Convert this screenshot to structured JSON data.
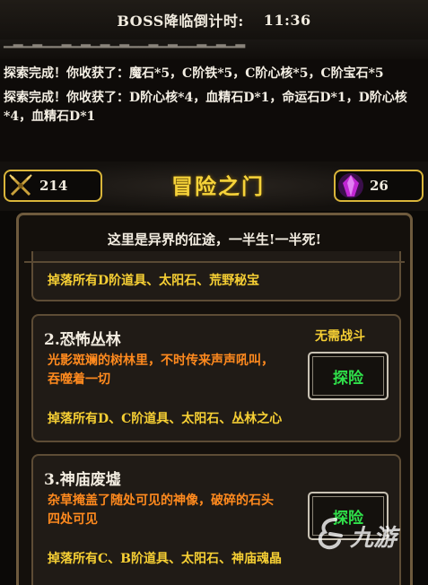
{
  "top_bar": {
    "countdown_label": "BOSS降临倒计时:",
    "countdown_time": "11:36"
  },
  "log": {
    "entries": [
      "探索完成！你收获了：魔石*5，C阶铁*5，C阶心核*5，C阶宝石*5",
      "探索完成！你收获了：D阶心核*4，血精石D*1，命运石D*1，D阶心核*4，血精石D*1"
    ]
  },
  "header": {
    "left_stat": {
      "icon": "crossed-swords-icon",
      "value": "214"
    },
    "title": "冒险之门",
    "right_stat": {
      "icon": "purple-crystal-icon",
      "value": "26"
    }
  },
  "panel": {
    "subtitle": "这里是异界的征途，一半生!一半死!",
    "cards": [
      {
        "drops": "掉落所有D阶道具、太阳石、荒野秘宝"
      },
      {
        "name": "2.恐怖丛林",
        "tag": "无需战斗",
        "description": "光影斑斓的树林里，不时传来声声吼叫，吞噬着一切",
        "button": "探险",
        "drops": "掉落所有D、C阶道具、太阳石、丛林之心"
      },
      {
        "name": "3.神庙废墟",
        "description": "杂草掩盖了随处可见的神像，破碎的石头四处可见",
        "button": "探险",
        "drops": "掉落所有C、B阶道具、太阳石、神庙魂晶"
      }
    ]
  },
  "watermark": {
    "text": "九游",
    "icon": "jiuyou-logo-icon"
  },
  "colors": {
    "accent_gold": "#f6cf34",
    "title_yellow": "#f6d33a",
    "description_orange": "#ff8a1e",
    "button_green": "#2fe04a",
    "stat_border": "#d9b53a"
  }
}
